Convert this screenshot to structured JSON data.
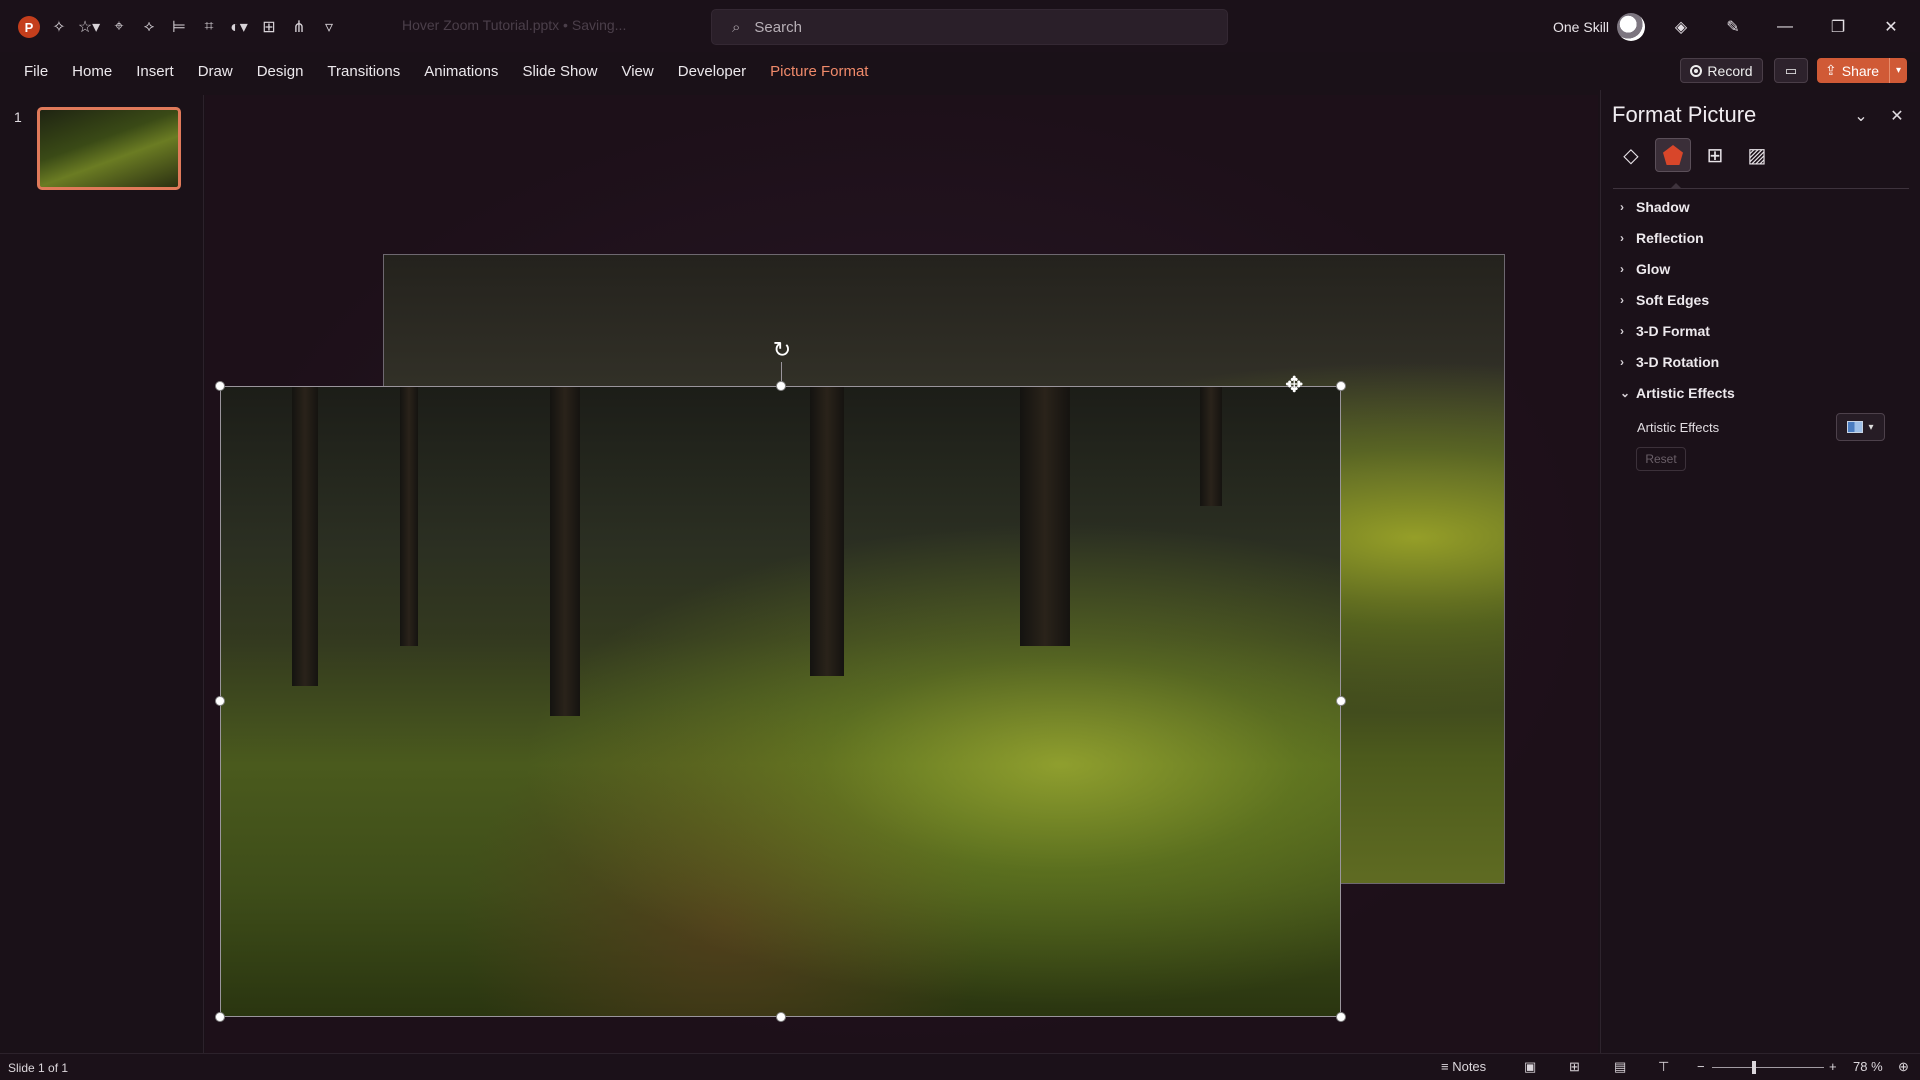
{
  "app": {
    "doc_title": "Hover Zoom Tutorial.pptx • Saving...",
    "logo": "P"
  },
  "search": {
    "placeholder": "Search",
    "icon": "search-icon"
  },
  "user": {
    "name": "One Skill"
  },
  "tabs": [
    {
      "label": "File"
    },
    {
      "label": "Home"
    },
    {
      "label": "Insert"
    },
    {
      "label": "Draw"
    },
    {
      "label": "Design"
    },
    {
      "label": "Transitions"
    },
    {
      "label": "Animations"
    },
    {
      "label": "Slide Show"
    },
    {
      "label": "View"
    },
    {
      "label": "Developer"
    },
    {
      "label": "Picture Format",
      "active": true
    }
  ],
  "actions": {
    "record": "Record",
    "share": "Share"
  },
  "slides": {
    "current_number": "1"
  },
  "format_pane": {
    "title": "Format Picture",
    "sections": [
      {
        "label": "Shadow",
        "expanded": false
      },
      {
        "label": "Reflection",
        "expanded": false
      },
      {
        "label": "Glow",
        "expanded": false
      },
      {
        "label": "Soft Edges",
        "expanded": false
      },
      {
        "label": "3-D Format",
        "expanded": false
      },
      {
        "label": "3-D Rotation",
        "expanded": false
      },
      {
        "label": "Artistic Effects",
        "expanded": true
      }
    ],
    "artistic_effects_label": "Artistic Effects",
    "reset_label": "Reset"
  },
  "status": {
    "slide_info": "Slide 1 of 1",
    "notes": "Notes",
    "zoom": "78 %"
  },
  "colors": {
    "accent": "#f08a6a",
    "share_bg": "#d05a36",
    "effects_icon_active": "#d8462a"
  }
}
